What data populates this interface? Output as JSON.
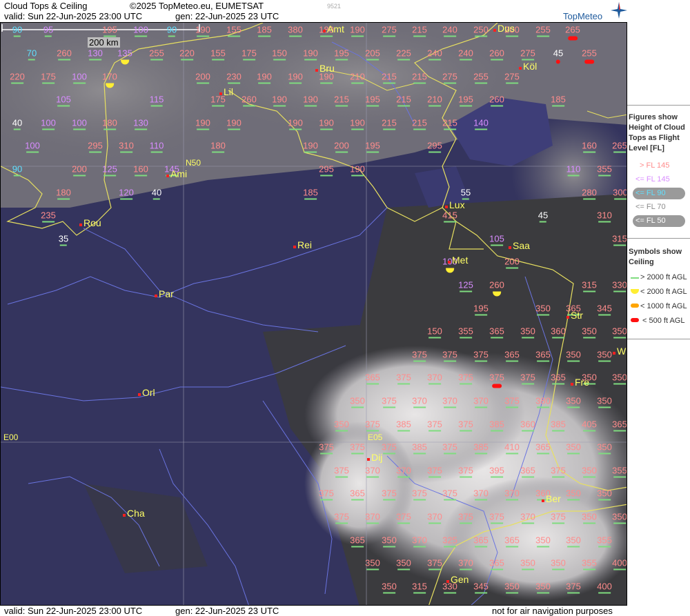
{
  "header": {
    "title": "Cloud Tops & Ceiling",
    "copyright": "©2025 TopMeteo.eu, EUMETSAT",
    "valid_top": "valid:  Sun  22-Jun-2025  23:00 UTC",
    "gen_top": "gen: 22-Jun-2025 23 UTC",
    "small_id": "9521",
    "logo": "TopMeteo"
  },
  "footer": {
    "valid": "valid:  Sun  22-Jun-2025  23:00 UTC",
    "gen": "gen: 22-Jun-2025 23 UTC",
    "note": "not for air navigation purposes"
  },
  "scale_label": "200 km",
  "grid_labels": {
    "n50": "N50",
    "e00": "E00",
    "e05": "E05"
  },
  "cities": [
    {
      "name": "Amt"
    },
    {
      "name": "Dus"
    },
    {
      "name": "Köl"
    },
    {
      "name": "Bru"
    },
    {
      "name": "Lil"
    },
    {
      "name": "Ami"
    },
    {
      "name": "Lux"
    },
    {
      "name": "Rou"
    },
    {
      "name": "Saa"
    },
    {
      "name": "Rei"
    },
    {
      "name": "Met"
    },
    {
      "name": "Par"
    },
    {
      "name": "Str"
    },
    {
      "name": "Orl"
    },
    {
      "name": "Fre"
    },
    {
      "name": "Dij"
    },
    {
      "name": "Ber"
    },
    {
      "name": "Cha"
    },
    {
      "name": "Gen"
    },
    {
      "name": "W"
    }
  ],
  "legend": {
    "title1": "Figures show Height of Cloud Tops as Flight Level  [FL]",
    "fl_items": [
      "> FL 145",
      "<= FL 145",
      "<= FL 90",
      "<= FL 70",
      "<= FL 50"
    ],
    "title2": "Symbols show Ceiling",
    "sym_items": [
      "> 2000 ft AGL",
      "< 2000 ft AGL",
      "< 1000 ft AGL",
      "< 500 ft AGL"
    ],
    "colors": {
      "high": "#ff8c8c",
      "mid": "#d88cff",
      "low": "#5fe0ff",
      "white": "#ffffff",
      "grey": "#c8c8c8",
      "green": "#7fdc7f",
      "yellow": "#ffee33",
      "orange": "#ffa500",
      "red": "#ff1010"
    }
  },
  "labels": [
    {
      "v": "90",
      "c": "cyan"
    },
    {
      "v": "95",
      "c": "mag"
    },
    {
      "v": "195",
      "c": "red"
    },
    {
      "v": "100",
      "c": "mag"
    },
    {
      "v": "90",
      "c": "cyan"
    },
    {
      "v": "190",
      "c": "red"
    },
    {
      "v": "155",
      "c": "red"
    },
    {
      "v": "185",
      "c": "red"
    },
    {
      "v": "380",
      "c": "red"
    },
    {
      "v": "180",
      "c": "red"
    },
    {
      "v": "190",
      "c": "red"
    },
    {
      "v": "275",
      "c": "red"
    },
    {
      "v": "215",
      "c": "red"
    },
    {
      "v": "240",
      "c": "red"
    },
    {
      "v": "250",
      "c": "red"
    },
    {
      "v": "200",
      "c": "red"
    },
    {
      "v": "255",
      "c": "red"
    },
    {
      "v": "265",
      "c": "red",
      "s": "r"
    },
    {
      "v": "70",
      "c": "cyan"
    },
    {
      "v": "260",
      "c": "red"
    },
    {
      "v": "130",
      "c": "mag"
    },
    {
      "v": "135",
      "c": "mag",
      "s": "y"
    },
    {
      "v": "255",
      "c": "red"
    },
    {
      "v": "220",
      "c": "red"
    },
    {
      "v": "155",
      "c": "red"
    },
    {
      "v": "175",
      "c": "red"
    },
    {
      "v": "150",
      "c": "red"
    },
    {
      "v": "190",
      "c": "red"
    },
    {
      "v": "195",
      "c": "red"
    },
    {
      "v": "205",
      "c": "red"
    },
    {
      "v": "225",
      "c": "red"
    },
    {
      "v": "240",
      "c": "red"
    },
    {
      "v": "240",
      "c": "red"
    },
    {
      "v": "260",
      "c": "red"
    },
    {
      "v": "275",
      "c": "red"
    },
    {
      "v": "45",
      "c": "white",
      "s": "r"
    },
    {
      "v": "255",
      "c": "red",
      "s": "r"
    },
    {
      "v": "220",
      "c": "red"
    },
    {
      "v": "175",
      "c": "red"
    },
    {
      "v": "100",
      "c": "mag"
    },
    {
      "v": "170",
      "c": "red",
      "s": "y"
    },
    {
      "v": "200",
      "c": "red"
    },
    {
      "v": "230",
      "c": "red"
    },
    {
      "v": "190",
      "c": "red"
    },
    {
      "v": "190",
      "c": "red"
    },
    {
      "v": "190",
      "c": "red"
    },
    {
      "v": "210",
      "c": "red"
    },
    {
      "v": "215",
      "c": "red"
    },
    {
      "v": "215",
      "c": "red"
    },
    {
      "v": "275",
      "c": "red"
    },
    {
      "v": "255",
      "c": "red"
    },
    {
      "v": "275",
      "c": "red"
    },
    {
      "v": "105",
      "c": "mag"
    },
    {
      "v": "115",
      "c": "mag"
    },
    {
      "v": "175",
      "c": "red"
    },
    {
      "v": "260",
      "c": "red"
    },
    {
      "v": "190",
      "c": "red"
    },
    {
      "v": "190",
      "c": "red"
    },
    {
      "v": "215",
      "c": "red"
    },
    {
      "v": "195",
      "c": "red"
    },
    {
      "v": "215",
      "c": "red"
    },
    {
      "v": "210",
      "c": "red"
    },
    {
      "v": "195",
      "c": "red"
    },
    {
      "v": "260",
      "c": "red"
    },
    {
      "v": "185",
      "c": "red"
    },
    {
      "v": "40",
      "c": "white"
    },
    {
      "v": "100",
      "c": "mag"
    },
    {
      "v": "100",
      "c": "mag"
    },
    {
      "v": "180",
      "c": "red"
    },
    {
      "v": "130",
      "c": "mag"
    },
    {
      "v": "190",
      "c": "red"
    },
    {
      "v": "190",
      "c": "red"
    },
    {
      "v": "190",
      "c": "red"
    },
    {
      "v": "190",
      "c": "red"
    },
    {
      "v": "190",
      "c": "red"
    },
    {
      "v": "215",
      "c": "red"
    },
    {
      "v": "215",
      "c": "red"
    },
    {
      "v": "215",
      "c": "red"
    },
    {
      "v": "140",
      "c": "mag"
    },
    {
      "v": "100",
      "c": "mag"
    },
    {
      "v": "295",
      "c": "red"
    },
    {
      "v": "310",
      "c": "red"
    },
    {
      "v": "110",
      "c": "mag"
    },
    {
      "v": "180",
      "c": "red"
    },
    {
      "v": "190",
      "c": "red"
    },
    {
      "v": "200",
      "c": "red"
    },
    {
      "v": "195",
      "c": "red"
    },
    {
      "v": "295",
      "c": "red"
    },
    {
      "v": "160",
      "c": "red"
    },
    {
      "v": "265",
      "c": "red"
    },
    {
      "v": "90",
      "c": "cyan"
    },
    {
      "v": "200",
      "c": "red"
    },
    {
      "v": "125",
      "c": "mag"
    },
    {
      "v": "160",
      "c": "red"
    },
    {
      "v": "145",
      "c": "mag"
    },
    {
      "v": "295",
      "c": "red"
    },
    {
      "v": "190",
      "c": "red"
    },
    {
      "v": "110",
      "c": "mag"
    },
    {
      "v": "355",
      "c": "red"
    },
    {
      "v": "180",
      "c": "red"
    },
    {
      "v": "120",
      "c": "mag"
    },
    {
      "v": "40",
      "c": "white"
    },
    {
      "v": "185",
      "c": "red"
    },
    {
      "v": "55",
      "c": "white"
    },
    {
      "v": "280",
      "c": "red"
    },
    {
      "v": "300",
      "c": "red"
    },
    {
      "v": "235",
      "c": "red"
    },
    {
      "v": "415",
      "c": "red"
    },
    {
      "v": "45",
      "c": "white"
    },
    {
      "v": "310",
      "c": "red"
    },
    {
      "v": "35",
      "c": "white"
    },
    {
      "v": "105",
      "c": "mag"
    },
    {
      "v": "315",
      "c": "red"
    },
    {
      "v": "100",
      "c": "mag",
      "s": "y"
    },
    {
      "v": "200",
      "c": "red"
    },
    {
      "v": "125",
      "c": "mag"
    },
    {
      "v": "260",
      "c": "red",
      "s": "y"
    },
    {
      "v": "315",
      "c": "red"
    },
    {
      "v": "330",
      "c": "red"
    },
    {
      "v": "195",
      "c": "red"
    },
    {
      "v": "350",
      "c": "red"
    },
    {
      "v": "365",
      "c": "red"
    },
    {
      "v": "345",
      "c": "red"
    },
    {
      "v": "150",
      "c": "red"
    },
    {
      "v": "355",
      "c": "red"
    },
    {
      "v": "365",
      "c": "red"
    },
    {
      "v": "350",
      "c": "red"
    },
    {
      "v": "360",
      "c": "red"
    },
    {
      "v": "350",
      "c": "red"
    },
    {
      "v": "350",
      "c": "red"
    },
    {
      "v": "375",
      "c": "red"
    },
    {
      "v": "375",
      "c": "red"
    },
    {
      "v": "375",
      "c": "red"
    },
    {
      "v": "365",
      "c": "red"
    },
    {
      "v": "365",
      "c": "red"
    },
    {
      "v": "350",
      "c": "red"
    },
    {
      "v": "350",
      "c": "red"
    },
    {
      "v": "365",
      "c": "red"
    },
    {
      "v": "375",
      "c": "red"
    },
    {
      "v": "370",
      "c": "red"
    },
    {
      "v": "375",
      "c": "red"
    },
    {
      "v": "375",
      "c": "red",
      "s": "r"
    },
    {
      "v": "375",
      "c": "red"
    },
    {
      "v": "365",
      "c": "red"
    },
    {
      "v": "350",
      "c": "red"
    },
    {
      "v": "350",
      "c": "red"
    },
    {
      "v": "350",
      "c": "red"
    },
    {
      "v": "375",
      "c": "red"
    },
    {
      "v": "370",
      "c": "red"
    },
    {
      "v": "370",
      "c": "red"
    },
    {
      "v": "370",
      "c": "red"
    },
    {
      "v": "375",
      "c": "red"
    },
    {
      "v": "380",
      "c": "red"
    },
    {
      "v": "350",
      "c": "red"
    },
    {
      "v": "350",
      "c": "red"
    },
    {
      "v": "350",
      "c": "red"
    },
    {
      "v": "375",
      "c": "red"
    },
    {
      "v": "385",
      "c": "red"
    },
    {
      "v": "375",
      "c": "red"
    },
    {
      "v": "375",
      "c": "red"
    },
    {
      "v": "385",
      "c": "red"
    },
    {
      "v": "360",
      "c": "red"
    },
    {
      "v": "385",
      "c": "red"
    },
    {
      "v": "405",
      "c": "red"
    },
    {
      "v": "365",
      "c": "red"
    },
    {
      "v": "375",
      "c": "red"
    },
    {
      "v": "375",
      "c": "red"
    },
    {
      "v": "375",
      "c": "red"
    },
    {
      "v": "385",
      "c": "red"
    },
    {
      "v": "375",
      "c": "red"
    },
    {
      "v": "385",
      "c": "red"
    },
    {
      "v": "410",
      "c": "red"
    },
    {
      "v": "365",
      "c": "red"
    },
    {
      "v": "350",
      "c": "red"
    },
    {
      "v": "350",
      "c": "red"
    },
    {
      "v": "375",
      "c": "red"
    },
    {
      "v": "370",
      "c": "red"
    },
    {
      "v": "370",
      "c": "red"
    },
    {
      "v": "375",
      "c": "red"
    },
    {
      "v": "375",
      "c": "red"
    },
    {
      "v": "395",
      "c": "red"
    },
    {
      "v": "365",
      "c": "red"
    },
    {
      "v": "375",
      "c": "red"
    },
    {
      "v": "350",
      "c": "red"
    },
    {
      "v": "355",
      "c": "red"
    },
    {
      "v": "375",
      "c": "red"
    },
    {
      "v": "365",
      "c": "red"
    },
    {
      "v": "375",
      "c": "red"
    },
    {
      "v": "375",
      "c": "red"
    },
    {
      "v": "375",
      "c": "red"
    },
    {
      "v": "370",
      "c": "red"
    },
    {
      "v": "370",
      "c": "red"
    },
    {
      "v": "360",
      "c": "red"
    },
    {
      "v": "350",
      "c": "red"
    },
    {
      "v": "350",
      "c": "red"
    },
    {
      "v": "375",
      "c": "red"
    },
    {
      "v": "370",
      "c": "red"
    },
    {
      "v": "375",
      "c": "red"
    },
    {
      "v": "370",
      "c": "red"
    },
    {
      "v": "375",
      "c": "red"
    },
    {
      "v": "375",
      "c": "red"
    },
    {
      "v": "370",
      "c": "red"
    },
    {
      "v": "375",
      "c": "red"
    },
    {
      "v": "350",
      "c": "red"
    },
    {
      "v": "350",
      "c": "red"
    },
    {
      "v": "370",
      "c": "red"
    },
    {
      "v": "365",
      "c": "red"
    },
    {
      "v": "350",
      "c": "red"
    },
    {
      "v": "370",
      "c": "red"
    },
    {
      "v": "325",
      "c": "red"
    },
    {
      "v": "365",
      "c": "red"
    },
    {
      "v": "365",
      "c": "red"
    },
    {
      "v": "350",
      "c": "red"
    },
    {
      "v": "350",
      "c": "red"
    },
    {
      "v": "355",
      "c": "red"
    },
    {
      "v": "350",
      "c": "red"
    },
    {
      "v": "350",
      "c": "red"
    },
    {
      "v": "375",
      "c": "red"
    },
    {
      "v": "370",
      "c": "red"
    },
    {
      "v": "365",
      "c": "red"
    },
    {
      "v": "350",
      "c": "red"
    },
    {
      "v": "350",
      "c": "red"
    },
    {
      "v": "355",
      "c": "red"
    },
    {
      "v": "400",
      "c": "red"
    },
    {
      "v": "350",
      "c": "red"
    },
    {
      "v": "315",
      "c": "red"
    },
    {
      "v": "330",
      "c": "red"
    },
    {
      "v": "345",
      "c": "red"
    },
    {
      "v": "350",
      "c": "red"
    },
    {
      "v": "350",
      "c": "red"
    },
    {
      "v": "375",
      "c": "red"
    },
    {
      "v": "400",
      "c": "red"
    }
  ]
}
